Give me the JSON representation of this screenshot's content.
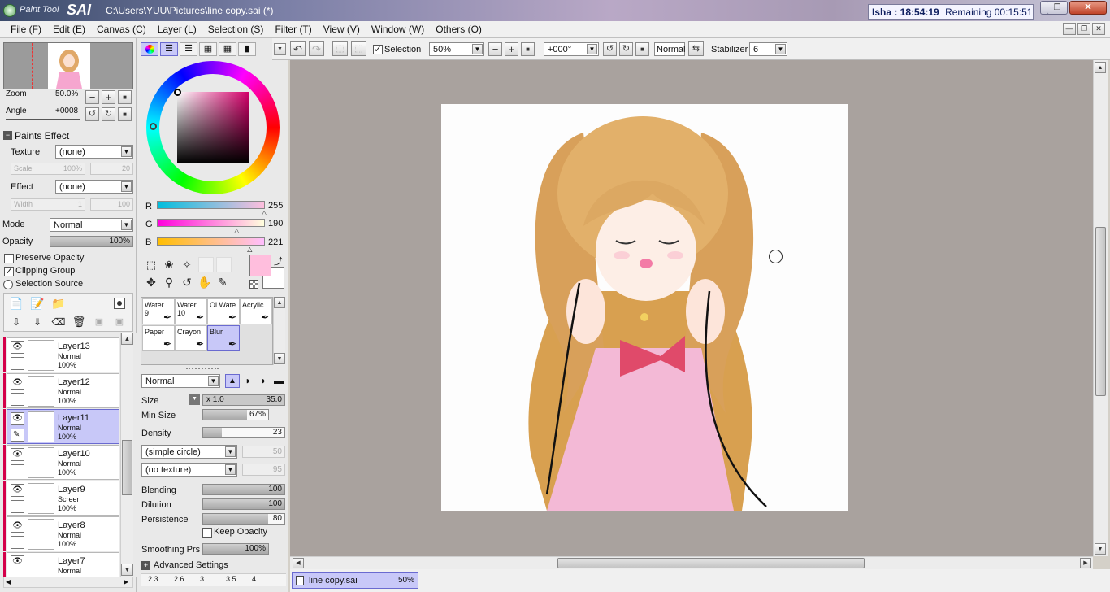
{
  "window": {
    "app_logo_prefix": "Paint",
    "app_logo_mid": "Tool",
    "app_logo_main": "SAI",
    "file_path": "C:\\Users\\YUU\\Pictures\\line copy.sai (*)",
    "clock_label": "Isha : 18:54:19",
    "remaining_label": "Remaining 00:15:51",
    "btn_min": "‒",
    "btn_max": "❐",
    "btn_close": "✕"
  },
  "menu": [
    "File (F)",
    "Edit (E)",
    "Canvas (C)",
    "Layer (L)",
    "Selection (S)",
    "Filter (T)",
    "View (V)",
    "Window (W)",
    "Others (O)"
  ],
  "navigator": {
    "zoom_label": "Zoom",
    "zoom_value": "50.0%",
    "angle_label": "Angle",
    "angle_value": "+0008"
  },
  "paints_effect": {
    "header": "Paints Effect",
    "texture_label": "Texture",
    "texture_value": "(none)",
    "scale_label": "Scale",
    "scale_value": "100%",
    "scale_num": "20",
    "effect_label": "Effect",
    "effect_value": "(none)",
    "width_label": "Width",
    "width_value": "1",
    "width_num": "100"
  },
  "layer_props": {
    "mode_label": "Mode",
    "mode_value": "Normal",
    "opacity_label": "Opacity",
    "opacity_value": "100%",
    "opacity_level": 1.0,
    "preserve_opacity": "Preserve Opacity",
    "clipping_group": "Clipping Group",
    "selection_source": "Selection Source"
  },
  "layers": [
    {
      "name": "Layer13",
      "mode": "Normal",
      "opacity": "100%",
      "selected": false
    },
    {
      "name": "Layer12",
      "mode": "Normal",
      "opacity": "100%",
      "selected": false
    },
    {
      "name": "Layer11",
      "mode": "Normal",
      "opacity": "100%",
      "selected": true
    },
    {
      "name": "Layer10",
      "mode": "Normal",
      "opacity": "100%",
      "selected": false
    },
    {
      "name": "Layer9",
      "mode": "Screen",
      "opacity": "100%",
      "selected": false
    },
    {
      "name": "Layer8",
      "mode": "Normal",
      "opacity": "100%",
      "selected": false
    },
    {
      "name": "Layer7",
      "mode": "Normal",
      "opacity": "",
      "selected": false
    }
  ],
  "color": {
    "r_label": "R",
    "r_value": "255",
    "r_level": 1.0,
    "g_label": "G",
    "g_value": "190",
    "g_level": 0.745,
    "b_label": "B",
    "b_value": "221",
    "b_level": 0.867,
    "primary": "#ffbedd",
    "secondary": "#ffffff"
  },
  "brushes": [
    {
      "name": "Water 9",
      "line1": "Water",
      "line2": "9",
      "active": false
    },
    {
      "name": "Water 10",
      "line1": "Water",
      "line2": "10",
      "active": false
    },
    {
      "name": "Ol Water",
      "line1": "Ol Wate",
      "line2": "",
      "active": false
    },
    {
      "name": "Acrylic",
      "line1": "Acrylic",
      "line2": "",
      "active": false
    },
    {
      "name": "Paper",
      "line1": "Paper",
      "line2": "",
      "active": false
    },
    {
      "name": "Crayon",
      "line1": "Crayon",
      "line2": "",
      "active": false
    },
    {
      "name": "Blur",
      "line1": "Blur",
      "line2": "",
      "active": true
    }
  ],
  "brush_settings": {
    "blend_mode": "Normal",
    "size_label": "Size",
    "size_mult": "x 1.0",
    "size_value": "35.0",
    "min_size_label": "Min Size",
    "min_size_value": "67%",
    "min_size_level": 0.67,
    "density_label": "Density",
    "density_value": "23",
    "density_level": 0.23,
    "shape": "(simple circle)",
    "shape_num": "50",
    "texture": "(no texture)",
    "texture_num": "95",
    "blending_label": "Blending",
    "blending_value": "100",
    "dilution_label": "Dilution",
    "dilution_value": "100",
    "persistence_label": "Persistence",
    "persistence_value": "80",
    "persistence_level": 0.8,
    "keep_opacity": "Keep Opacity",
    "smoothing_label": "Smoothing Prs",
    "smoothing_value": "100%",
    "advanced": "Advanced Settings",
    "size_presets": [
      "2.3",
      "2.6",
      "3",
      "3.5",
      "4"
    ]
  },
  "toolbar": {
    "selection_label": "Selection",
    "zoom_value": "50%",
    "angle_value": "+000°",
    "mode_value": "Normal",
    "stabilizer_label": "Stabilizer",
    "stabilizer_value": "6"
  },
  "status_tab": {
    "file": "line copy.sai",
    "zoom": "50%"
  }
}
